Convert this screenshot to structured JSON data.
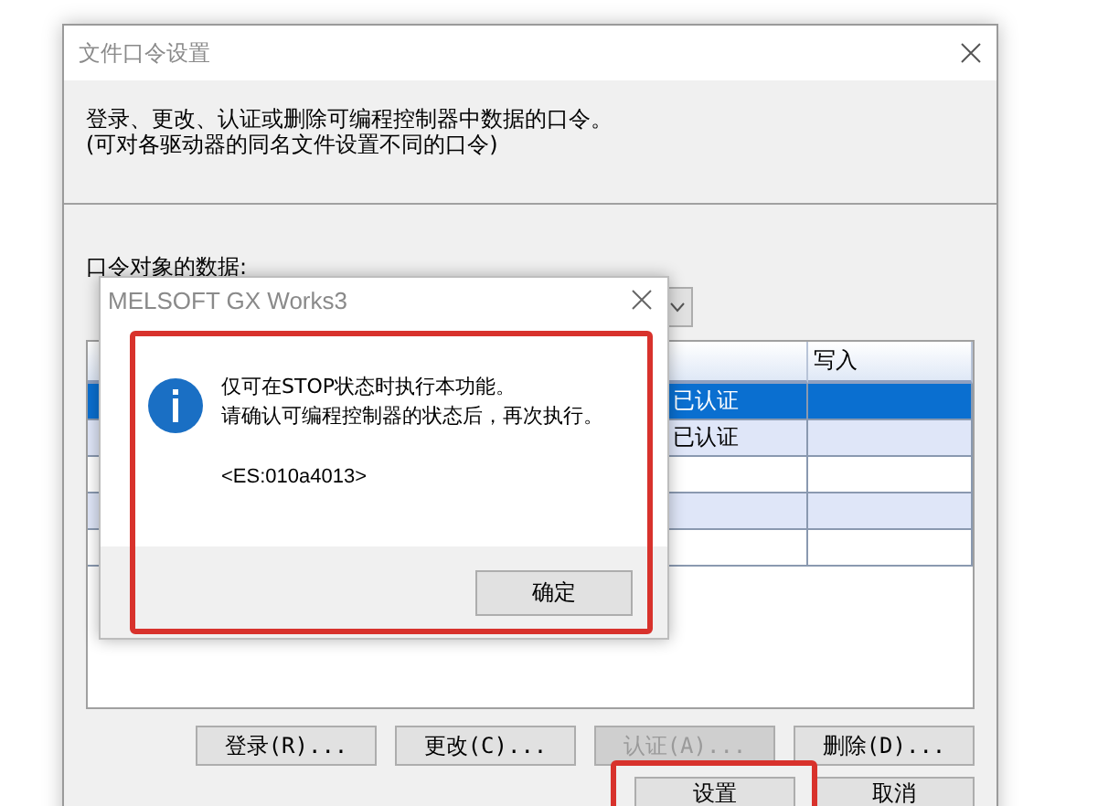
{
  "window": {
    "title": "文件口令设置"
  },
  "description": [
    "登录、更改、认证或删除可编程控制器中数据的口令。",
    "(可对各驱动器的同名文件设置不同的口令)"
  ],
  "section_label": "口令对象的数据:",
  "table": {
    "columns": [
      "写入"
    ],
    "rows": [
      {
        "cells": [
          "已认证",
          ""
        ],
        "selected": true
      },
      {
        "cells": [
          "已认证",
          ""
        ],
        "selected": false
      },
      {
        "cells": [
          "",
          ""
        ],
        "selected": false
      },
      {
        "cells": [
          "",
          ""
        ],
        "selected": false
      },
      {
        "cells": [
          "",
          ""
        ],
        "selected": false
      }
    ]
  },
  "buttons": [
    {
      "label": "登录(R)...",
      "disabled": false
    },
    {
      "label": "更改(C)...",
      "disabled": false
    },
    {
      "label": "认证(A)...",
      "disabled": true
    },
    {
      "label": "删除(D)...",
      "disabled": false
    }
  ],
  "footer_buttons": [
    {
      "label": "设置"
    },
    {
      "label": "取消"
    }
  ],
  "message_box": {
    "title": "MELSOFT GX Works3",
    "lines": [
      "仅可在STOP状态时执行本功能。",
      "请确认可编程控制器的状态后，再次执行。"
    ],
    "code": "<ES:010a4013>",
    "button": "确定"
  }
}
